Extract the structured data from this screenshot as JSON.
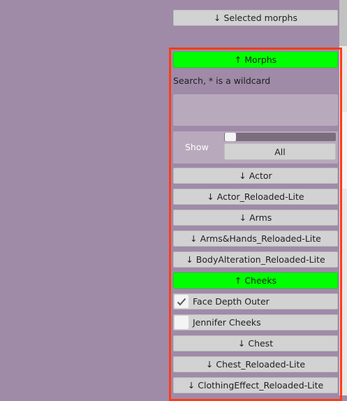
{
  "top_button": {
    "label": "↓ Selected morphs"
  },
  "morphs_header": {
    "label": "↑ Morphs"
  },
  "search": {
    "label": "Search, * is a wildcard",
    "value": ""
  },
  "show": {
    "label": "Show",
    "slider_value": 0,
    "all_label": "All"
  },
  "categories": [
    {
      "label": "↓ Actor"
    },
    {
      "label": "↓ Actor_Reloaded-Lite"
    },
    {
      "label": "↓ Arms"
    },
    {
      "label": "↓ Arms&Hands_Reloaded-Lite"
    },
    {
      "label": "↓ BodyAlteration_Reloaded-Lite"
    }
  ],
  "cheeks_header": {
    "label": "↑ Cheeks"
  },
  "morph_toggles": [
    {
      "label": "Face Depth Outer",
      "checked": true
    },
    {
      "label": "Jennifer Cheeks",
      "checked": false
    }
  ],
  "categories_after": [
    {
      "label": "↓ Chest"
    },
    {
      "label": "↓ Chest_Reloaded-Lite"
    },
    {
      "label": "↓ ClothingEffect_Reloaded-Lite"
    }
  ],
  "colors": {
    "background": "#9f8aa8",
    "header_green": "#00ff00",
    "highlight_frame": "#ff3b16"
  }
}
